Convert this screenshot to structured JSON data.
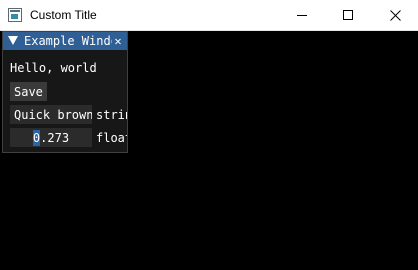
{
  "window": {
    "title": "Custom Title",
    "icons": {
      "app": "app-icon",
      "minimize": "minimize-icon",
      "maximize": "maximize-icon",
      "close": "close-icon"
    }
  },
  "panel": {
    "title": "Example Window",
    "collapse_icon": "triangle-down-icon",
    "close_glyph": "✕",
    "accent_color": "#2f5f95",
    "hello_text": "Hello, world",
    "save_label": "Save",
    "text_field": {
      "value": "Quick brown fox",
      "label": "string"
    },
    "float_field": {
      "value_highlight": "0",
      "value_rest": ".273",
      "label": "float"
    }
  }
}
